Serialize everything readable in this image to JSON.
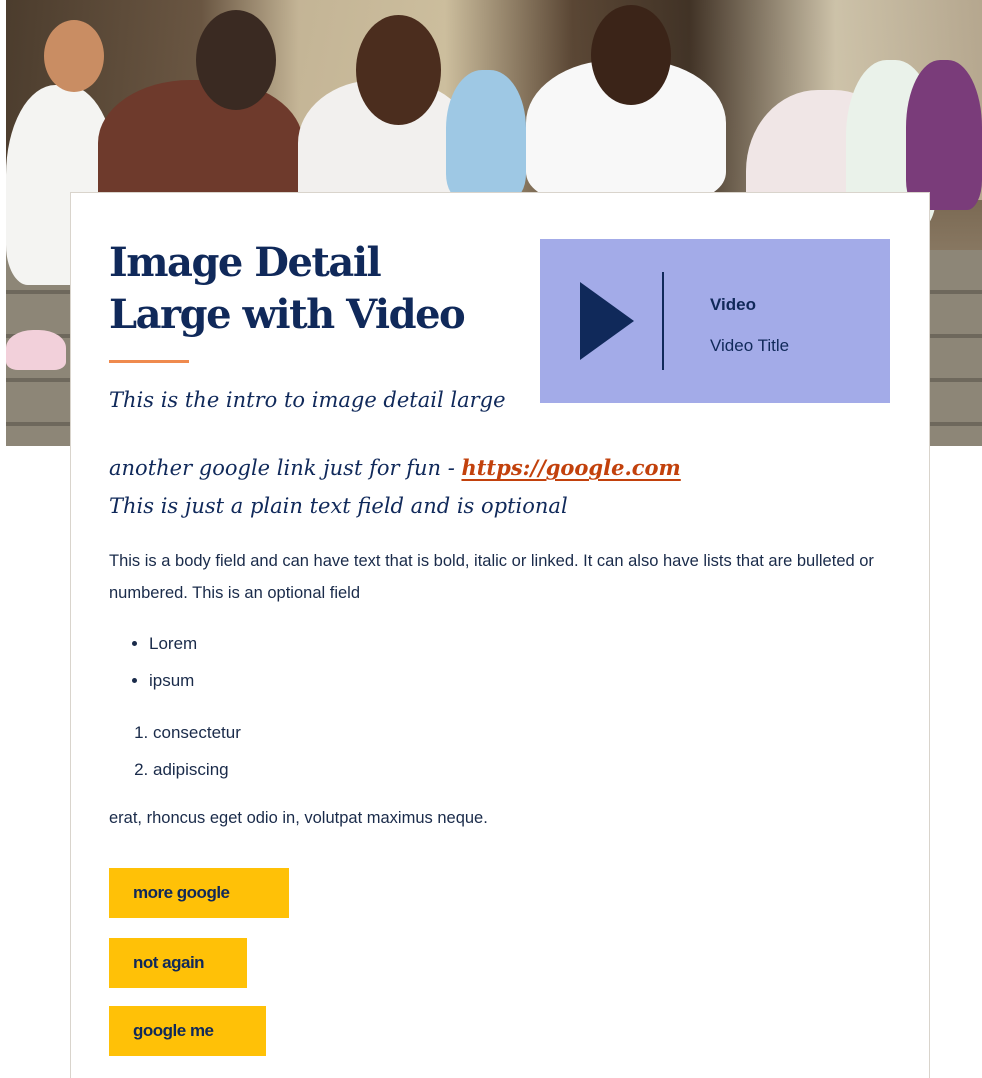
{
  "hero": {
    "alt": "Group of people seated on temple steps"
  },
  "card": {
    "title": "Image Detail Large with Video",
    "intro": {
      "line1": "This is the intro to image detail large",
      "line2_prefix": "another google link just for fun - ",
      "link_text": "https://google.com",
      "line3": "This is just a plain text field and is optional"
    },
    "body": "This is a body field and can have text that is bold, italic or linked. It can also have lists that are bulleted or numbered. This is an optional field",
    "bullets": [
      "Lorem",
      "ipsum"
    ],
    "numbered": [
      "consectetur",
      "adipiscing"
    ],
    "closing": "erat, rhoncus eget odio in, volutpat maximus neque.",
    "buttons": [
      "more google",
      "not again",
      "google me"
    ]
  },
  "video": {
    "label": "Video",
    "title": "Video Title"
  },
  "colors": {
    "navy": "#10295a",
    "accent_orange": "#ef8a4e",
    "link": "#c2410c",
    "video_bg": "#a3abe8",
    "button_bg": "#ffc107"
  }
}
